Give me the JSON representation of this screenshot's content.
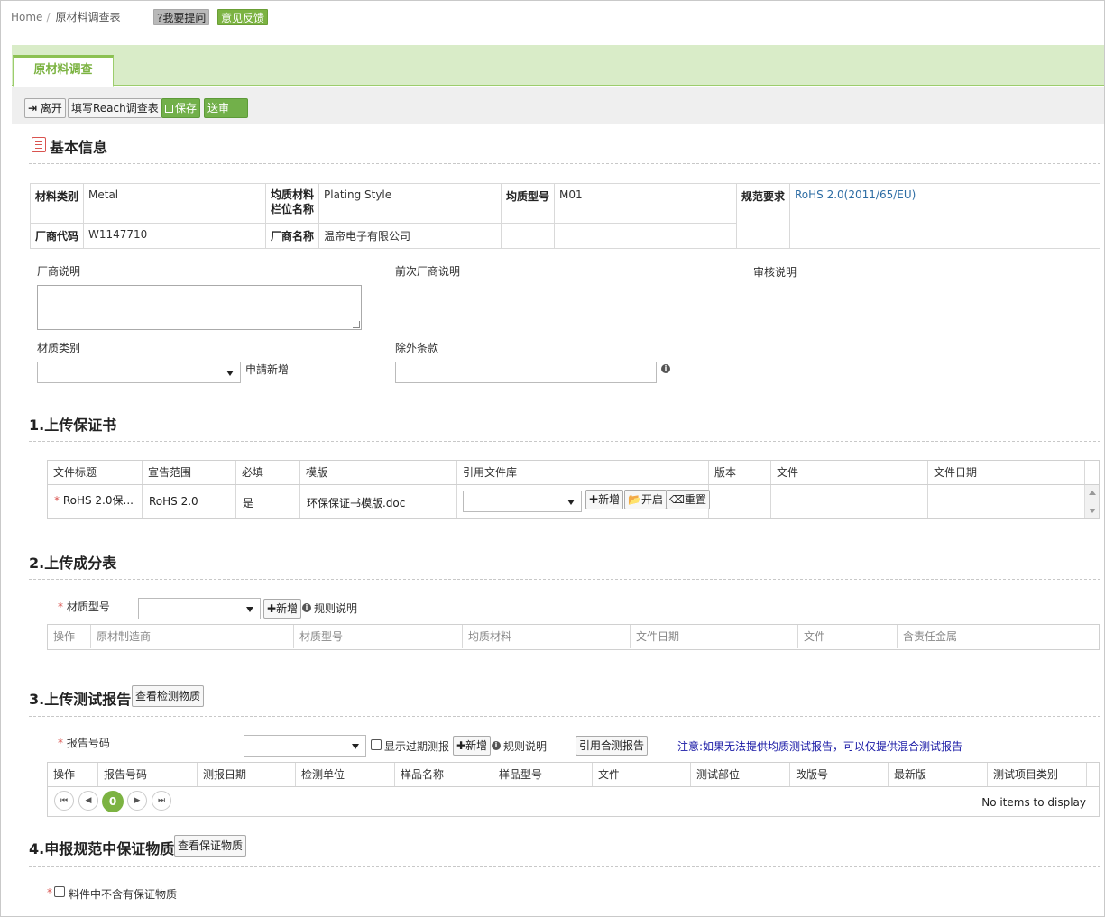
{
  "breadcrumb": {
    "home": "Home",
    "sep": "/",
    "current": "原材料调查表"
  },
  "top_chips": {
    "ask": "?我要提问",
    "feedback": "意见反馈"
  },
  "tab": {
    "label": "原材料调查"
  },
  "toolbar": {
    "leave": "离开",
    "reach": "填写Reach调查表",
    "save": "保存",
    "submit": "送审"
  },
  "basic": {
    "title": "基本信息",
    "material_type_k": "材料类别",
    "material_type_v": "Metal",
    "homog_k1": "均质材料",
    "homog_k2": "栏位名称",
    "homog_v": "Plating Style",
    "model_k": "均质型号",
    "model_v": "M01",
    "spec_k": "规范要求",
    "spec_v": "RoHS 2.0(2011/65/EU)",
    "vendor_code_k": "厂商代码",
    "vendor_code_v": "W1147710",
    "vendor_name_k": "厂商名称",
    "vendor_name_v": "温帝电子有限公司",
    "vendor_note": "厂商说明",
    "prev_vendor_note": "前次厂商说明",
    "review_note": "审核说明",
    "material_class": "材质类别",
    "apply_new": "申請新增",
    "exemption": "除外条款"
  },
  "sec1": {
    "title": "1.上传保证书",
    "columns": [
      "文件标题",
      "宣告范围",
      "必填",
      "模版",
      "引用文件库",
      "版本",
      "文件",
      "文件日期"
    ],
    "row": {
      "title": "RoHS 2.0保...",
      "scope": "RoHS 2.0",
      "required": "是",
      "template": "环保保证书模版.doc",
      "add": "新增",
      "open": "开启",
      "reset": "重置"
    }
  },
  "sec2": {
    "title": "2.上传成分表",
    "model_label": "材质型号",
    "add": "新增",
    "rules": "规则说明",
    "columns": [
      "操作",
      "原材制造商",
      "材质型号",
      "均质材料",
      "文件日期",
      "文件",
      "含责任金属"
    ]
  },
  "sec3": {
    "title": "3.上传测试报告",
    "view_btn": "查看检测物质",
    "report_label": "报告号码",
    "show_expired": "显示过期测报",
    "add": "新增",
    "rules": "规则说明",
    "ref_btn": "引用合测报告",
    "notice": "注意:如果无法提供均质测试报告，可以仅提供混合测试报告",
    "columns": [
      "操作",
      "报告号码",
      "测报日期",
      "检测单位",
      "样品名称",
      "样品型号",
      "文件",
      "测试部位",
      "改版号",
      "最新版",
      "测试项目类别"
    ],
    "page": "0",
    "empty": "No items to display"
  },
  "sec4": {
    "title": "4.申报规范中保证物质",
    "view_btn": "查看保证物质",
    "no_sub": "料件中不含有保证物质"
  },
  "colors": {
    "accent": "#7cb342",
    "link": "#2e6da4",
    "notice": "#1a1aa6"
  }
}
